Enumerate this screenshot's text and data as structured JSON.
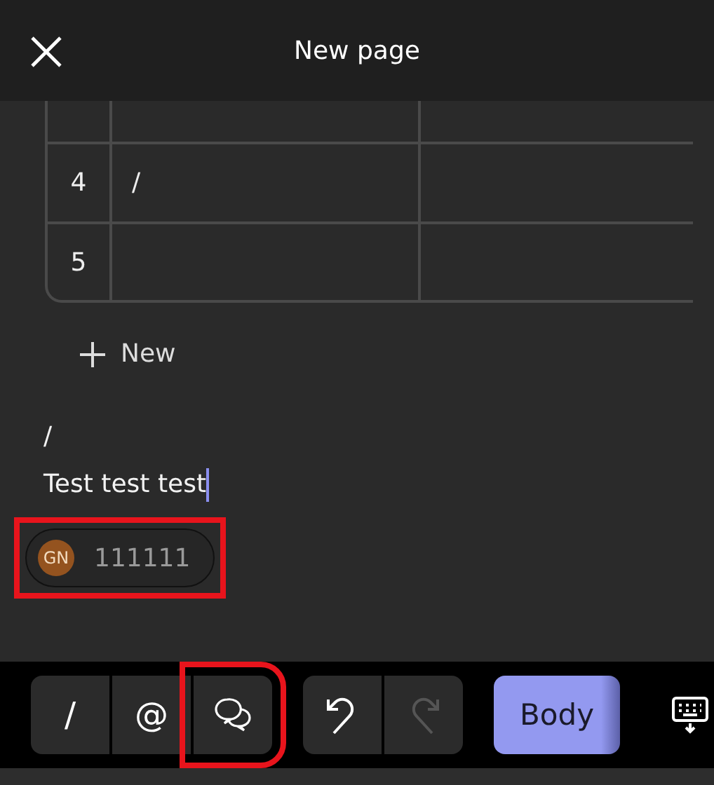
{
  "header": {
    "title": "New page"
  },
  "table": {
    "rows": [
      {
        "cells": [
          "",
          ""
        ]
      },
      {
        "index": "4",
        "cells": [
          "/",
          ""
        ]
      },
      {
        "index": "5",
        "cells": [
          "",
          ""
        ]
      }
    ]
  },
  "new_row": {
    "label": "New"
  },
  "paragraphs": [
    {
      "text": "/",
      "cursor": false
    },
    {
      "text": "Test test test",
      "cursor": true
    }
  ],
  "comment_chip": {
    "initials": "GN",
    "text": "111111",
    "highlighted": true
  },
  "toolbar": {
    "groups": [
      [
        {
          "kind": "slash",
          "label": "/",
          "disabled": false,
          "highlighted": false
        },
        {
          "kind": "mention",
          "label": "@",
          "disabled": false,
          "highlighted": false
        },
        {
          "kind": "comment",
          "disabled": false,
          "highlighted": true
        }
      ],
      [
        {
          "kind": "undo",
          "disabled": false,
          "highlighted": false
        },
        {
          "kind": "redo",
          "disabled": true,
          "highlighted": false
        }
      ]
    ],
    "style_button": {
      "label": "Body"
    }
  }
}
